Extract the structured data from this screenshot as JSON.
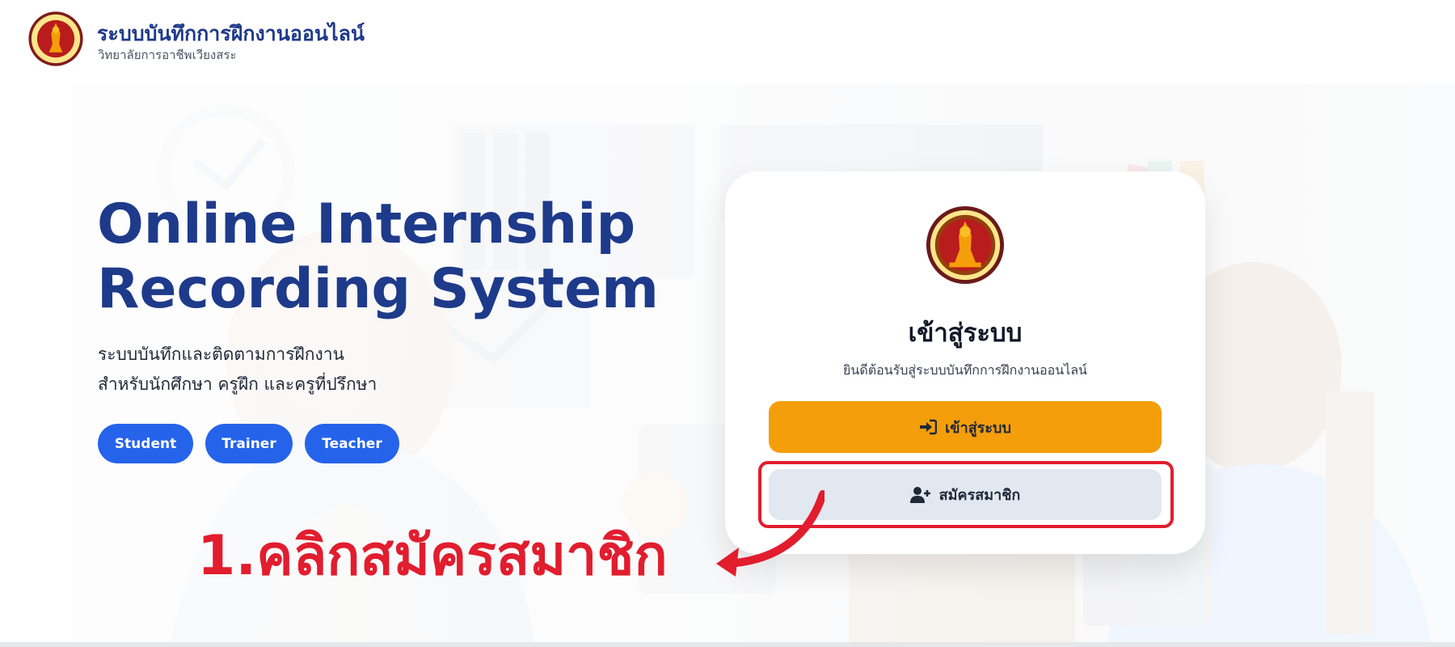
{
  "header": {
    "title": "ระบบบันทึกการฝึกงานออนไลน์",
    "subtitle": "วิทยาลัยการอาชีพเวียงสระ"
  },
  "hero": {
    "title_line1": "Online Internship",
    "title_line2": "Recording System",
    "desc_line1": "ระบบบันทึกและติดตามการฝึกงาน",
    "desc_line2": "สำหรับนักศึกษา ครูฝึก และครูที่ปรึกษา",
    "roles": [
      "Student",
      "Trainer",
      "Teacher"
    ]
  },
  "login_card": {
    "title": "เข้าสู่ระบบ",
    "subtitle": "ยินดีต้อนรับสู่ระบบบันทึกการฝึกงานออนไลน์",
    "login_button": "เข้าสู่ระบบ",
    "login_icon": "sign-in-icon",
    "register_button": "สมัครสมาชิก",
    "register_icon": "user-plus-icon"
  },
  "annotation": {
    "text": "1.คลิกสมัครสมาชิก",
    "color": "#e11d2e"
  },
  "colors": {
    "brand": "#1e3a8a",
    "pill": "#2563eb",
    "login_button": "#f59e0b",
    "register_button": "#e2e8f0"
  }
}
